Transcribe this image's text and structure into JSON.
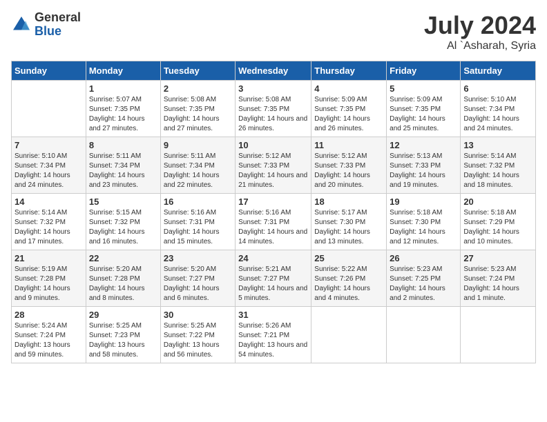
{
  "header": {
    "logo_general": "General",
    "logo_blue": "Blue",
    "month": "July 2024",
    "location": "Al `Asharah, Syria"
  },
  "days_of_week": [
    "Sunday",
    "Monday",
    "Tuesday",
    "Wednesday",
    "Thursday",
    "Friday",
    "Saturday"
  ],
  "weeks": [
    [
      {
        "day": "",
        "sunrise": "",
        "sunset": "",
        "daylight": ""
      },
      {
        "day": "1",
        "sunrise": "Sunrise: 5:07 AM",
        "sunset": "Sunset: 7:35 PM",
        "daylight": "Daylight: 14 hours and 27 minutes."
      },
      {
        "day": "2",
        "sunrise": "Sunrise: 5:08 AM",
        "sunset": "Sunset: 7:35 PM",
        "daylight": "Daylight: 14 hours and 27 minutes."
      },
      {
        "day": "3",
        "sunrise": "Sunrise: 5:08 AM",
        "sunset": "Sunset: 7:35 PM",
        "daylight": "Daylight: 14 hours and 26 minutes."
      },
      {
        "day": "4",
        "sunrise": "Sunrise: 5:09 AM",
        "sunset": "Sunset: 7:35 PM",
        "daylight": "Daylight: 14 hours and 26 minutes."
      },
      {
        "day": "5",
        "sunrise": "Sunrise: 5:09 AM",
        "sunset": "Sunset: 7:35 PM",
        "daylight": "Daylight: 14 hours and 25 minutes."
      },
      {
        "day": "6",
        "sunrise": "Sunrise: 5:10 AM",
        "sunset": "Sunset: 7:34 PM",
        "daylight": "Daylight: 14 hours and 24 minutes."
      }
    ],
    [
      {
        "day": "7",
        "sunrise": "Sunrise: 5:10 AM",
        "sunset": "Sunset: 7:34 PM",
        "daylight": "Daylight: 14 hours and 24 minutes."
      },
      {
        "day": "8",
        "sunrise": "Sunrise: 5:11 AM",
        "sunset": "Sunset: 7:34 PM",
        "daylight": "Daylight: 14 hours and 23 minutes."
      },
      {
        "day": "9",
        "sunrise": "Sunrise: 5:11 AM",
        "sunset": "Sunset: 7:34 PM",
        "daylight": "Daylight: 14 hours and 22 minutes."
      },
      {
        "day": "10",
        "sunrise": "Sunrise: 5:12 AM",
        "sunset": "Sunset: 7:33 PM",
        "daylight": "Daylight: 14 hours and 21 minutes."
      },
      {
        "day": "11",
        "sunrise": "Sunrise: 5:12 AM",
        "sunset": "Sunset: 7:33 PM",
        "daylight": "Daylight: 14 hours and 20 minutes."
      },
      {
        "day": "12",
        "sunrise": "Sunrise: 5:13 AM",
        "sunset": "Sunset: 7:33 PM",
        "daylight": "Daylight: 14 hours and 19 minutes."
      },
      {
        "day": "13",
        "sunrise": "Sunrise: 5:14 AM",
        "sunset": "Sunset: 7:32 PM",
        "daylight": "Daylight: 14 hours and 18 minutes."
      }
    ],
    [
      {
        "day": "14",
        "sunrise": "Sunrise: 5:14 AM",
        "sunset": "Sunset: 7:32 PM",
        "daylight": "Daylight: 14 hours and 17 minutes."
      },
      {
        "day": "15",
        "sunrise": "Sunrise: 5:15 AM",
        "sunset": "Sunset: 7:32 PM",
        "daylight": "Daylight: 14 hours and 16 minutes."
      },
      {
        "day": "16",
        "sunrise": "Sunrise: 5:16 AM",
        "sunset": "Sunset: 7:31 PM",
        "daylight": "Daylight: 14 hours and 15 minutes."
      },
      {
        "day": "17",
        "sunrise": "Sunrise: 5:16 AM",
        "sunset": "Sunset: 7:31 PM",
        "daylight": "Daylight: 14 hours and 14 minutes."
      },
      {
        "day": "18",
        "sunrise": "Sunrise: 5:17 AM",
        "sunset": "Sunset: 7:30 PM",
        "daylight": "Daylight: 14 hours and 13 minutes."
      },
      {
        "day": "19",
        "sunrise": "Sunrise: 5:18 AM",
        "sunset": "Sunset: 7:30 PM",
        "daylight": "Daylight: 14 hours and 12 minutes."
      },
      {
        "day": "20",
        "sunrise": "Sunrise: 5:18 AM",
        "sunset": "Sunset: 7:29 PM",
        "daylight": "Daylight: 14 hours and 10 minutes."
      }
    ],
    [
      {
        "day": "21",
        "sunrise": "Sunrise: 5:19 AM",
        "sunset": "Sunset: 7:28 PM",
        "daylight": "Daylight: 14 hours and 9 minutes."
      },
      {
        "day": "22",
        "sunrise": "Sunrise: 5:20 AM",
        "sunset": "Sunset: 7:28 PM",
        "daylight": "Daylight: 14 hours and 8 minutes."
      },
      {
        "day": "23",
        "sunrise": "Sunrise: 5:20 AM",
        "sunset": "Sunset: 7:27 PM",
        "daylight": "Daylight: 14 hours and 6 minutes."
      },
      {
        "day": "24",
        "sunrise": "Sunrise: 5:21 AM",
        "sunset": "Sunset: 7:27 PM",
        "daylight": "Daylight: 14 hours and 5 minutes."
      },
      {
        "day": "25",
        "sunrise": "Sunrise: 5:22 AM",
        "sunset": "Sunset: 7:26 PM",
        "daylight": "Daylight: 14 hours and 4 minutes."
      },
      {
        "day": "26",
        "sunrise": "Sunrise: 5:23 AM",
        "sunset": "Sunset: 7:25 PM",
        "daylight": "Daylight: 14 hours and 2 minutes."
      },
      {
        "day": "27",
        "sunrise": "Sunrise: 5:23 AM",
        "sunset": "Sunset: 7:24 PM",
        "daylight": "Daylight: 14 hours and 1 minute."
      }
    ],
    [
      {
        "day": "28",
        "sunrise": "Sunrise: 5:24 AM",
        "sunset": "Sunset: 7:24 PM",
        "daylight": "Daylight: 13 hours and 59 minutes."
      },
      {
        "day": "29",
        "sunrise": "Sunrise: 5:25 AM",
        "sunset": "Sunset: 7:23 PM",
        "daylight": "Daylight: 13 hours and 58 minutes."
      },
      {
        "day": "30",
        "sunrise": "Sunrise: 5:25 AM",
        "sunset": "Sunset: 7:22 PM",
        "daylight": "Daylight: 13 hours and 56 minutes."
      },
      {
        "day": "31",
        "sunrise": "Sunrise: 5:26 AM",
        "sunset": "Sunset: 7:21 PM",
        "daylight": "Daylight: 13 hours and 54 minutes."
      },
      {
        "day": "",
        "sunrise": "",
        "sunset": "",
        "daylight": ""
      },
      {
        "day": "",
        "sunrise": "",
        "sunset": "",
        "daylight": ""
      },
      {
        "day": "",
        "sunrise": "",
        "sunset": "",
        "daylight": ""
      }
    ]
  ]
}
